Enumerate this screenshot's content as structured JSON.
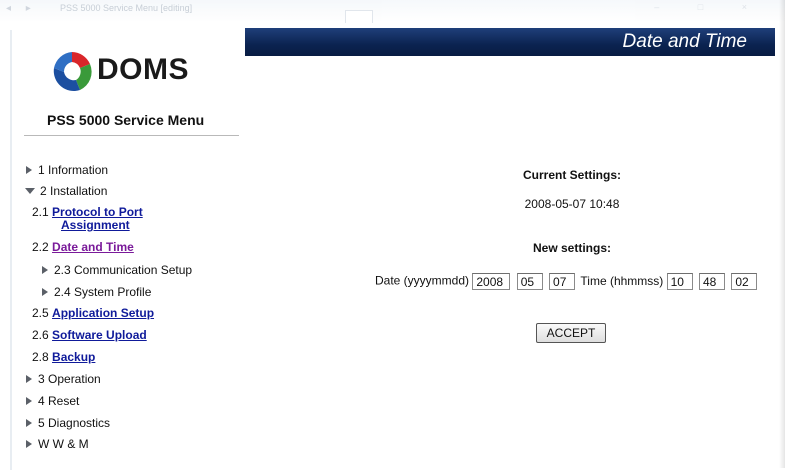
{
  "browser": {
    "tab_title": "PSS 5000 Service Menu [editing]"
  },
  "header": {
    "title": "Date and Time"
  },
  "brand": {
    "logo_text": "DOMS",
    "menu_title": "PSS 5000 Service Menu",
    "colors": {
      "red": "#d9262a",
      "green": "#3a9a3a",
      "blue": "#1c4fa0"
    }
  },
  "sidebar": {
    "items": [
      {
        "label": "1 Information",
        "icon": "arrow-right-icon"
      },
      {
        "label": "2 Installation",
        "icon": "arrow-down-icon"
      },
      {
        "prefix": "2.1",
        "label": "Protocol to Port",
        "label2": "Assignment"
      },
      {
        "prefix": "2.2",
        "label": "Date and Time"
      },
      {
        "label": "2.3 Communication Setup",
        "icon": "arrow-right-icon"
      },
      {
        "label": "2.4 System Profile",
        "icon": "arrow-right-icon"
      },
      {
        "prefix": "2.5",
        "label": "Application Setup"
      },
      {
        "prefix": "2.6",
        "label": "Software Upload"
      },
      {
        "prefix": "2.8",
        "label": "Backup"
      },
      {
        "label": "3 Operation",
        "icon": "arrow-right-icon"
      },
      {
        "label": "4 Reset",
        "icon": "arrow-right-icon"
      },
      {
        "label": "5 Diagnostics",
        "icon": "arrow-right-icon"
      },
      {
        "label": "W W & M",
        "icon": "arrow-right-icon"
      }
    ]
  },
  "main": {
    "current_label": "Current Settings:",
    "current_value": "2008-05-07 10:48",
    "new_label": "New settings:",
    "date_label": "Date (yyyymmdd)",
    "year": "2008",
    "month": "05",
    "day": "07",
    "time_label": "Time (hhmmss)",
    "hour": "10",
    "minute": "48",
    "second": "02",
    "accept_label": "ACCEPT"
  }
}
